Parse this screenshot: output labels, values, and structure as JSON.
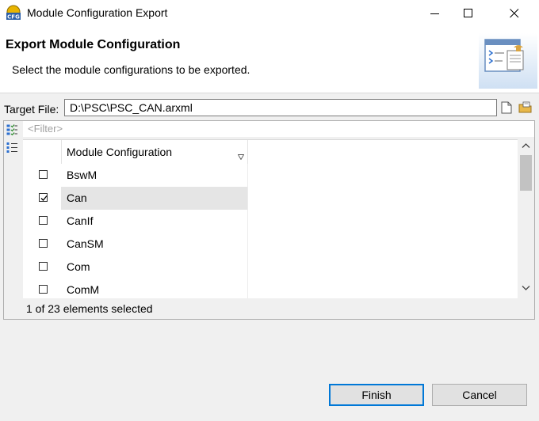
{
  "window": {
    "title": "Module Configuration Export",
    "icon_label": "CFG"
  },
  "banner": {
    "title": "Export Module Configuration",
    "description": "Select the module configurations to be exported."
  },
  "target": {
    "label": "Target File:",
    "value": "D:\\PSC\\PSC_CAN.arxml"
  },
  "filter": {
    "placeholder": "<Filter>"
  },
  "table": {
    "column_header": "Module Configuration",
    "rows": [
      {
        "name": "BswM",
        "checked": false
      },
      {
        "name": "Can",
        "checked": true
      },
      {
        "name": "CanIf",
        "checked": false
      },
      {
        "name": "CanSM",
        "checked": false
      },
      {
        "name": "Com",
        "checked": false
      },
      {
        "name": "ComM",
        "checked": false
      }
    ]
  },
  "status": "1 of 23 elements selected",
  "buttons": {
    "finish": "Finish",
    "cancel": "Cancel"
  }
}
